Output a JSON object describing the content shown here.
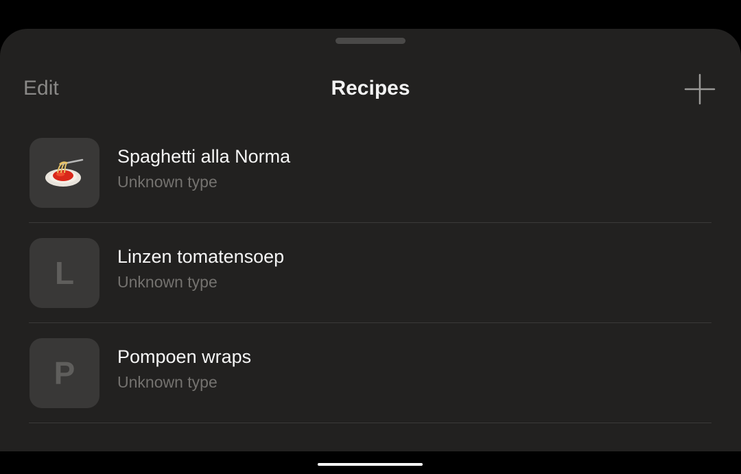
{
  "header": {
    "edit_label": "Edit",
    "title": "Recipes",
    "add_icon": "plus-icon"
  },
  "recipes": [
    {
      "title": "Spaghetti alla Norma",
      "subtitle": "Unknown type",
      "thumbnail": "spaghetti-icon"
    },
    {
      "title": "Linzen tomatensoep",
      "subtitle": "Unknown type",
      "thumbnail_letter": "L"
    },
    {
      "title": "Pompoen wraps",
      "subtitle": "Unknown type",
      "thumbnail_letter": "P"
    }
  ],
  "colors": {
    "background": "#000000",
    "sheet": "#222120",
    "thumbnail_bg": "#393837",
    "title_text": "#f5f5f5",
    "secondary_text": "#74726f"
  }
}
